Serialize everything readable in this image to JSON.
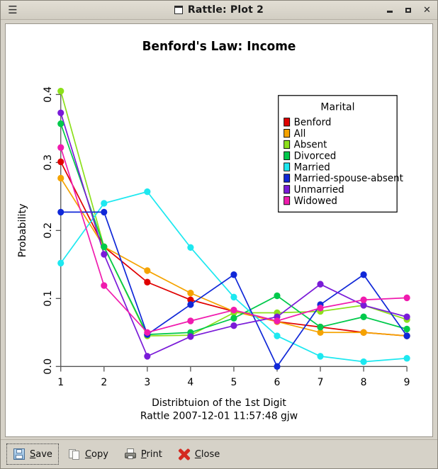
{
  "window": {
    "title": "Rattle: Plot 2",
    "menu_icon": "hamburger-icon",
    "title_icon": "window-icon",
    "minimize_label": "",
    "maximize_label": "",
    "close_label": "✕"
  },
  "toolbar": {
    "buttons": [
      {
        "label": "Save",
        "accel": "S",
        "icon": "floppy-disk-icon",
        "focused": true
      },
      {
        "label": "Copy",
        "accel": "C",
        "icon": "copy-pages-icon",
        "focused": false
      },
      {
        "label": "Print",
        "accel": "P",
        "icon": "printer-icon",
        "focused": false
      },
      {
        "label": "Close",
        "accel": "C",
        "icon": "red-x-icon",
        "focused": false
      }
    ]
  },
  "chart_data": {
    "type": "line",
    "title": "Benford's Law: Income",
    "xlabel": "Distribtuion of the 1st Digit",
    "sublabel": "Rattle 2007-12-01 11:57:48 gjw",
    "ylabel": "Probability",
    "legend_title": "Marital",
    "legend_position": "top-right",
    "grid": false,
    "x": [
      1,
      2,
      3,
      4,
      5,
      6,
      7,
      8,
      9
    ],
    "xticklabels": [
      "1",
      "2",
      "3",
      "4",
      "5",
      "6",
      "7",
      "8",
      "9"
    ],
    "xlim": [
      1,
      9
    ],
    "ylim": [
      0.0,
      0.42
    ],
    "yticks": [
      0.0,
      0.1,
      0.2,
      0.3,
      0.4
    ],
    "yticklabels": [
      "0.0",
      "0.1",
      "0.2",
      "0.3",
      "0.4"
    ],
    "series": [
      {
        "name": "Benford",
        "color": "#E00000",
        "values": [
          0.301,
          0.176,
          0.124,
          0.098,
          0.081,
          0.066,
          0.058,
          0.05,
          0.045
        ]
      },
      {
        "name": "All",
        "color": "#F5A300",
        "values": [
          0.277,
          0.176,
          0.141,
          0.108,
          0.081,
          0.066,
          0.05,
          0.05,
          0.045
        ]
      },
      {
        "name": "Absent",
        "color": "#8CE01B",
        "values": [
          0.405,
          0.176,
          0.045,
          0.046,
          0.079,
          0.079,
          0.081,
          0.09,
          0.069
        ]
      },
      {
        "name": "Divorced",
        "color": "#00C94B",
        "values": [
          0.357,
          0.176,
          0.047,
          0.05,
          0.071,
          0.104,
          0.058,
          0.073,
          0.055
        ]
      },
      {
        "name": "Married",
        "color": "#1DE8F0",
        "values": [
          0.152,
          0.24,
          0.257,
          0.175,
          0.102,
          0.045,
          0.015,
          0.007,
          0.012
        ]
      },
      {
        "name": "Married-spouse-absent",
        "color": "#1028D8",
        "values": [
          0.227,
          0.227,
          0.047,
          0.091,
          0.135,
          0.0,
          0.091,
          0.135,
          0.045
        ]
      },
      {
        "name": "Unmarried",
        "color": "#7A1BD8",
        "values": [
          0.373,
          0.165,
          0.015,
          0.044,
          0.06,
          0.073,
          0.121,
          0.09,
          0.073
        ]
      },
      {
        "name": "Widowed",
        "color": "#F01BAE",
        "values": [
          0.322,
          0.119,
          0.05,
          0.067,
          0.083,
          0.067,
          0.086,
          0.098,
          0.101
        ]
      }
    ]
  }
}
